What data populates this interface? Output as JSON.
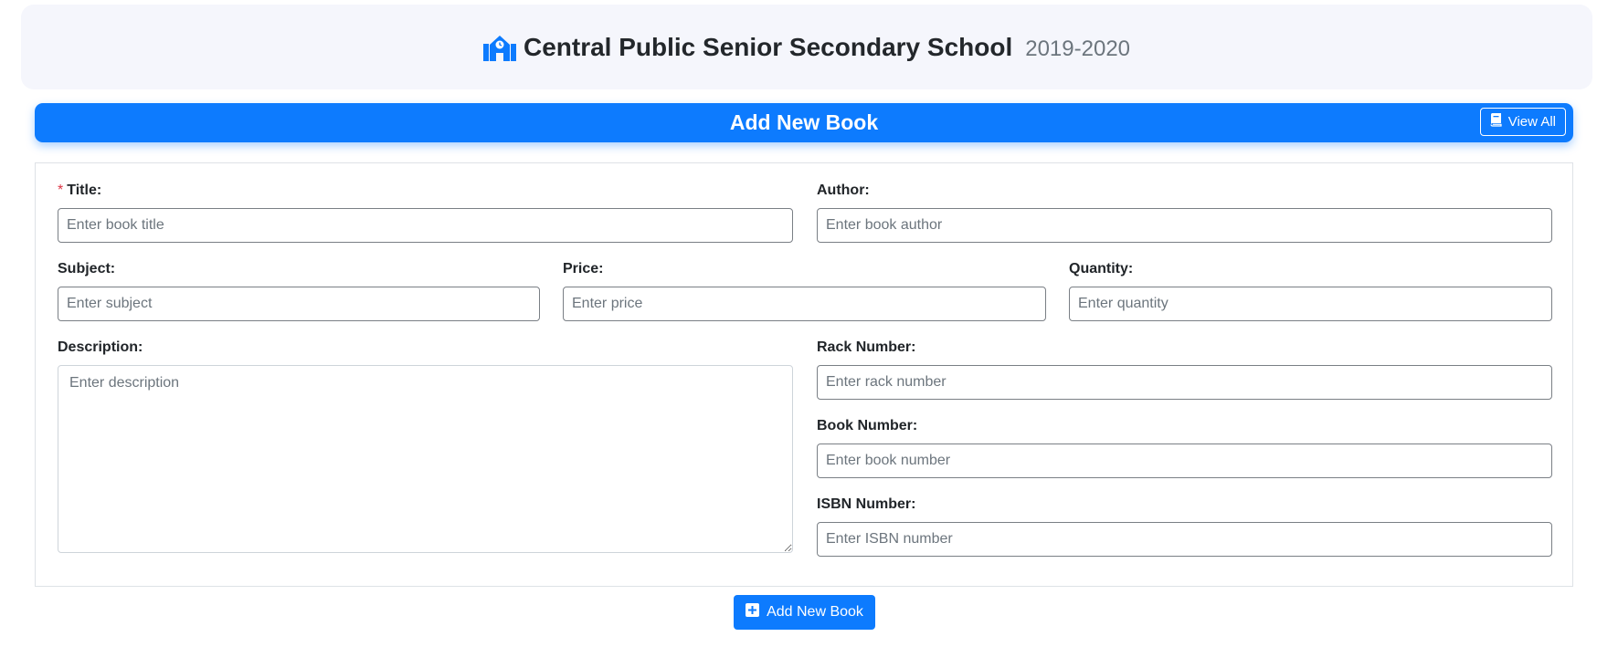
{
  "header": {
    "school_name": "Central Public Senior Secondary School",
    "session": "2019-2020",
    "icon": "school-icon"
  },
  "form": {
    "title": "Add New Book",
    "view_all_label": "View All",
    "view_all_icon": "book-icon",
    "fields": {
      "title": {
        "label": "Title:",
        "required_marker": "*",
        "placeholder": "Enter book title",
        "value": ""
      },
      "author": {
        "label": "Author:",
        "placeholder": "Enter book author",
        "value": ""
      },
      "subject": {
        "label": "Subject:",
        "placeholder": "Enter subject",
        "value": ""
      },
      "price": {
        "label": "Price:",
        "placeholder": "Enter price",
        "value": ""
      },
      "quantity": {
        "label": "Quantity:",
        "placeholder": "Enter quantity",
        "value": ""
      },
      "description": {
        "label": "Description:",
        "placeholder": "Enter description",
        "value": ""
      },
      "rack_number": {
        "label": "Rack Number:",
        "placeholder": "Enter rack number",
        "value": ""
      },
      "book_number": {
        "label": "Book Number:",
        "placeholder": "Enter book number",
        "value": ""
      },
      "isbn_number": {
        "label": "ISBN Number:",
        "placeholder": "Enter ISBN number",
        "value": ""
      }
    },
    "submit_label": "Add New Book",
    "submit_icon": "plus-square-icon"
  },
  "colors": {
    "primary": "#0d7bfe",
    "header_bg": "#f5f6fc",
    "required": "#dc3545"
  }
}
